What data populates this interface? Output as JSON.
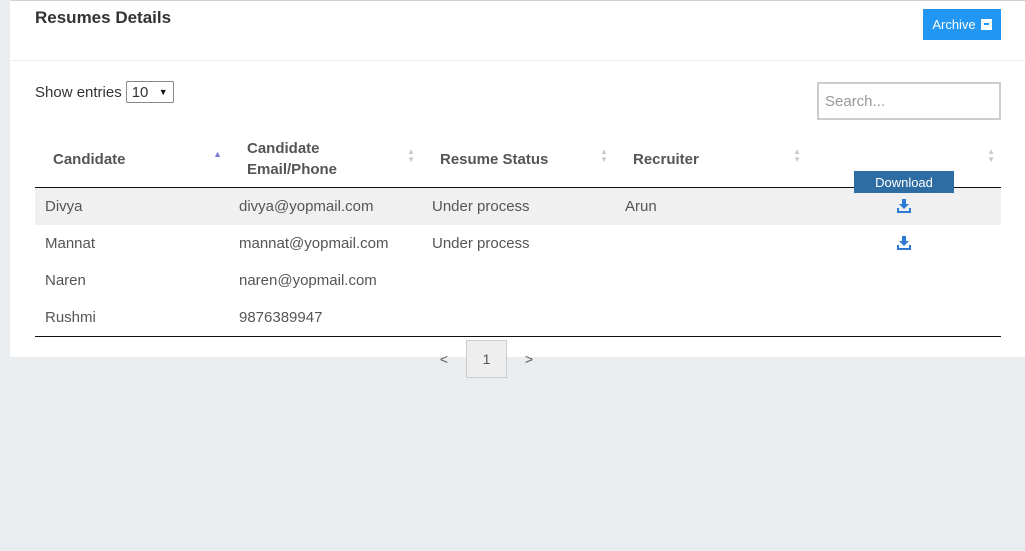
{
  "header": {
    "title": "Resumes Details",
    "archive_label": "Archive"
  },
  "controls": {
    "show_entries_label": "Show entries",
    "entries_value": "10",
    "search_placeholder": "Search..."
  },
  "table": {
    "columns": [
      {
        "line1": "Candidate",
        "line2": ""
      },
      {
        "line1": "Candidate",
        "line2": "Email/Phone"
      },
      {
        "line1": "Resume Status",
        "line2": ""
      },
      {
        "line1": "Recruiter",
        "line2": ""
      },
      {
        "line1": "",
        "line2": ""
      }
    ],
    "rows": [
      {
        "name": "Divya",
        "contact": "divya@yopmail.com",
        "status": "Under process",
        "recruiter": "Arun"
      },
      {
        "name": "Mannat",
        "contact": "mannat@yopmail.com",
        "status": "Under process",
        "recruiter": ""
      },
      {
        "name": "Naren",
        "contact": "naren@yopmail.com",
        "status": "",
        "recruiter": ""
      },
      {
        "name": "Rushmi",
        "contact": "9876389947",
        "status": "",
        "recruiter": ""
      }
    ],
    "tooltip": "Download",
    "download_icon": "download-icon"
  },
  "pagination": {
    "prev": "<",
    "current": "1",
    "next": ">"
  },
  "colors": {
    "accent": "#2196f3",
    "tooltip": "#2e6da4",
    "icon": "#2c7ad6"
  }
}
